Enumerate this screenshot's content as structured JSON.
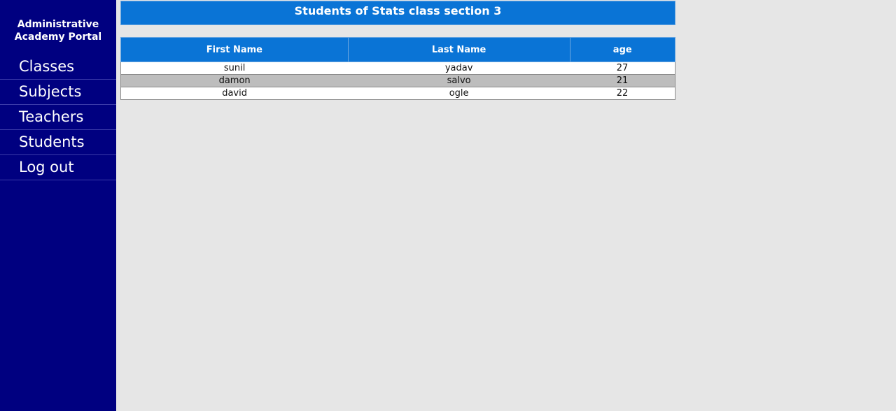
{
  "sidebar": {
    "brand_line1": "Administrative",
    "brand_line2": "Academy Portal",
    "items": [
      {
        "label": "Classes"
      },
      {
        "label": "Subjects"
      },
      {
        "label": "Teachers"
      },
      {
        "label": "Students"
      },
      {
        "label": "Log out"
      }
    ]
  },
  "main": {
    "title": "Students of Stats class section 3",
    "table": {
      "headers": [
        "First Name",
        "Last Name",
        "age"
      ],
      "rows": [
        [
          "sunil",
          "yadav",
          "27"
        ],
        [
          "damon",
          "salvo",
          "21"
        ],
        [
          "david",
          "ogle",
          "22"
        ]
      ]
    }
  },
  "colors": {
    "sidebar_bg": "#000080",
    "header_blue": "#0a74d6",
    "page_bg": "#e6e6e6",
    "row_alt": "#bdbdbd"
  }
}
